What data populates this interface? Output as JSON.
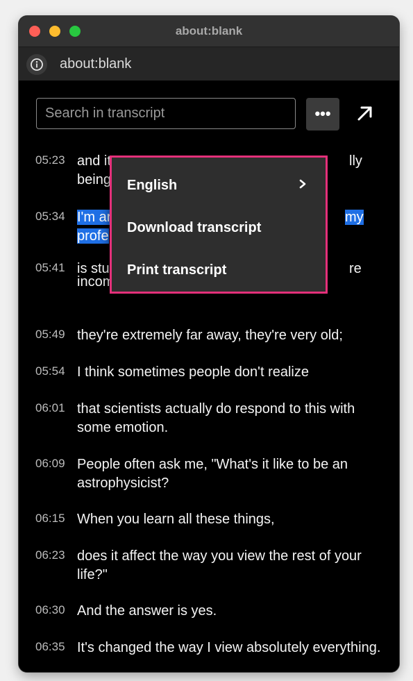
{
  "window": {
    "title": "about:blank",
    "url": "about:blank"
  },
  "search": {
    "placeholder": "Search in transcript",
    "value": ""
  },
  "toolbar": {
    "more_label": "•••"
  },
  "menu": {
    "items": [
      {
        "label": "English"
      },
      {
        "label": "Download transcript"
      },
      {
        "label": "Print transcript"
      }
    ]
  },
  "transcript": [
    {
      "time": "05:23",
      "text_a": "and it",
      "text_b": "lly",
      "text_c": "being"
    },
    {
      "time": "05:34",
      "text_a": "I'm ar",
      "text_b": "my",
      "text_c": "profe"
    },
    {
      "time": "05:41",
      "text_a": "is stu",
      "text_b": "re",
      "text_c": "incomprehensibly large,"
    },
    {
      "time": "05:49",
      "text": "they're extremely far away, they're very old;"
    },
    {
      "time": "05:54",
      "text": "I think sometimes people don't realize"
    },
    {
      "time": "06:01",
      "text": "that scientists actually do respond to this with some emotion."
    },
    {
      "time": "06:09",
      "text": "People often ask me, \"What's it like to be an astrophysicist?"
    },
    {
      "time": "06:15",
      "text": "When you learn all these things,"
    },
    {
      "time": "06:23",
      "text": "does it affect the way you view the rest of your life?\""
    },
    {
      "time": "06:30",
      "text": "And the answer is yes."
    },
    {
      "time": "06:35",
      "text": "It's changed the way I view absolutely everything."
    }
  ],
  "colors": {
    "highlight": "#1f6fe5",
    "menu_border": "#e4307a"
  }
}
